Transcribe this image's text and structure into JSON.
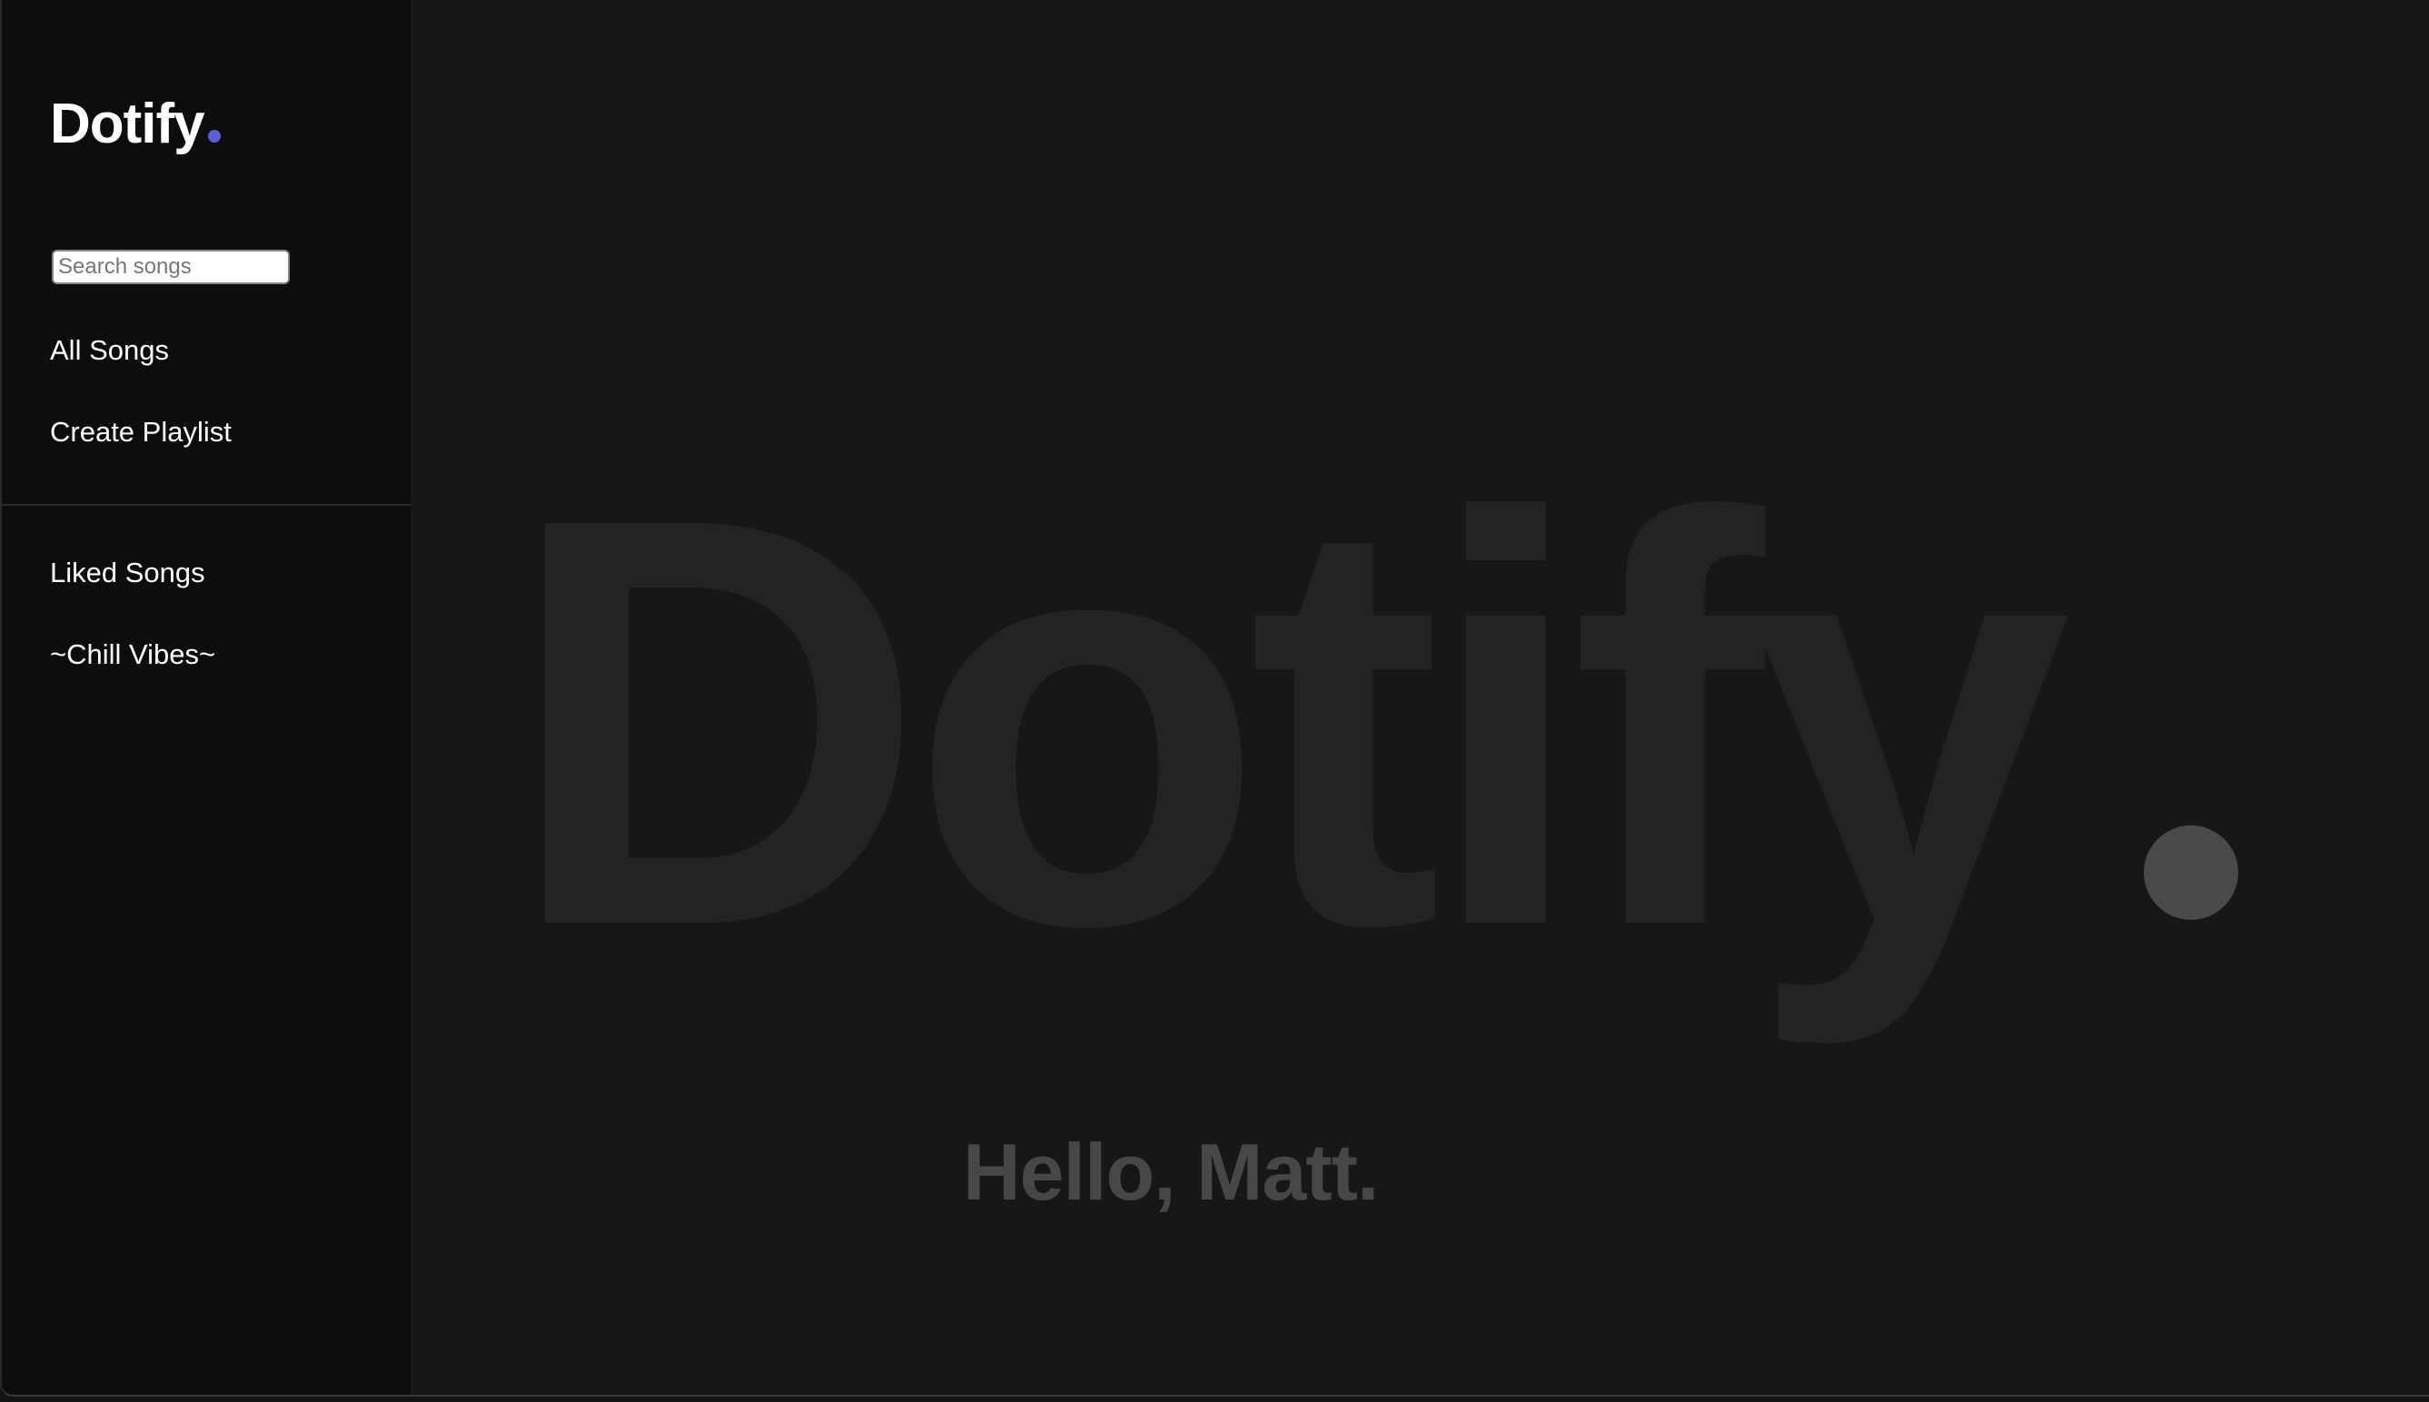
{
  "app": {
    "name": "Dotify",
    "accent_color": "#5a5fd6"
  },
  "sidebar": {
    "search": {
      "placeholder": "Search songs",
      "value": ""
    },
    "primary_items": [
      {
        "label": "All Songs"
      },
      {
        "label": "Create Playlist"
      }
    ],
    "playlists": [
      {
        "label": "Liked Songs"
      },
      {
        "label": "~Chill Vibes~"
      }
    ]
  },
  "main": {
    "watermark_text": "Dotify",
    "greeting": "Hello, Matt."
  }
}
